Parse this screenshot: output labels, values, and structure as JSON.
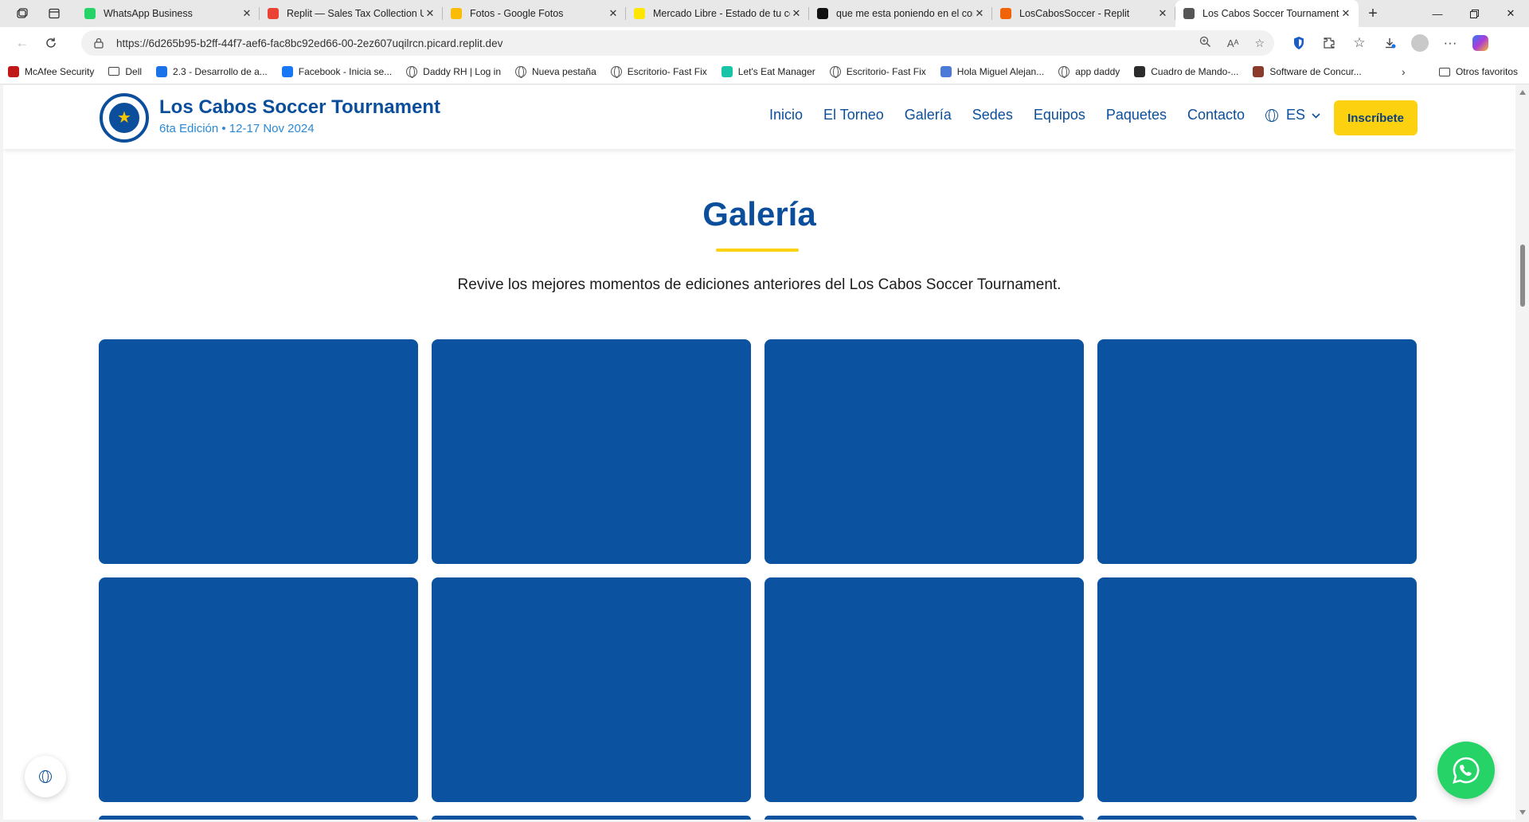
{
  "browser": {
    "tabs": [
      {
        "title": "WhatsApp Business",
        "icon": "whatsapp-icon",
        "color": "#25d366",
        "active": false
      },
      {
        "title": "Replit — Sales Tax Collection Up",
        "icon": "gmail-icon",
        "color": "#ea4335",
        "active": false
      },
      {
        "title": "Fotos - Google Fotos",
        "icon": "google-photos-icon",
        "color": "#fbbc05",
        "active": false
      },
      {
        "title": "Mercado Libre - Estado de tu co",
        "icon": "mercadolibre-icon",
        "color": "#ffe600",
        "active": false
      },
      {
        "title": "que me esta poniendo en el cor",
        "icon": "chatgpt-icon",
        "color": "#111111",
        "active": false
      },
      {
        "title": "LosCabosSoccer - Replit",
        "icon": "replit-icon",
        "color": "#f26207",
        "active": false
      },
      {
        "title": "Los Cabos Soccer Tournament -",
        "icon": "globe-icon",
        "color": "#555555",
        "active": true
      }
    ],
    "url": "https://6d265b95-b2ff-44f7-aef6-fac8bc92ed66-00-2ez607uqilrcn.picard.replit.dev",
    "bookmarks": [
      {
        "label": "McAfee Security",
        "icon": "mcafee-icon",
        "color": "#c01818"
      },
      {
        "label": "Dell",
        "icon": "folder-icon",
        "color": ""
      },
      {
        "label": "2.3 - Desarrollo de a...",
        "icon": "loading-icon",
        "color": "#1a73e8"
      },
      {
        "label": "Facebook - Inicia se...",
        "icon": "facebook-icon",
        "color": "#1877f2"
      },
      {
        "label": "Daddy RH | Log in",
        "icon": "globe-icon",
        "color": ""
      },
      {
        "label": "Nueva pestaña",
        "icon": "globe-icon",
        "color": ""
      },
      {
        "label": "Escritorio- Fast Fix",
        "icon": "globe-icon",
        "color": ""
      },
      {
        "label": "Let's Eat Manager",
        "icon": "letseat-icon",
        "color": "#18c4a8"
      },
      {
        "label": "Escritorio- Fast Fix",
        "icon": "globe-icon",
        "color": ""
      },
      {
        "label": "Hola Miguel Alejan...",
        "icon": "grid-icon",
        "color": "#4b7bd6"
      },
      {
        "label": "app daddy",
        "icon": "globe-icon",
        "color": ""
      },
      {
        "label": "Cuadro de Mando-...",
        "icon": "dashboard-icon",
        "color": "#2c2c2c"
      },
      {
        "label": "Software de Concur...",
        "icon": "tag-icon",
        "color": "#8b3a2b"
      }
    ],
    "other_favorites": "Otros favoritos"
  },
  "site": {
    "brand_title": "Los Cabos Soccer Tournament",
    "brand_subtitle": "6ta Edición • 12-17 Nov 2024",
    "menu": [
      "Inicio",
      "El Torneo",
      "Galería",
      "Sedes",
      "Equipos",
      "Paquetes",
      "Contacto"
    ],
    "language": "ES",
    "cta": "Inscríbete"
  },
  "gallery": {
    "title": "Galería",
    "description": "Revive los mejores momentos de ediciones anteriores del Los Cabos Soccer Tournament.",
    "tile_color": "#0b52a0"
  },
  "colors": {
    "primary": "#0b4f9c",
    "accent": "#fcd10f",
    "whatsapp": "#25d366"
  }
}
